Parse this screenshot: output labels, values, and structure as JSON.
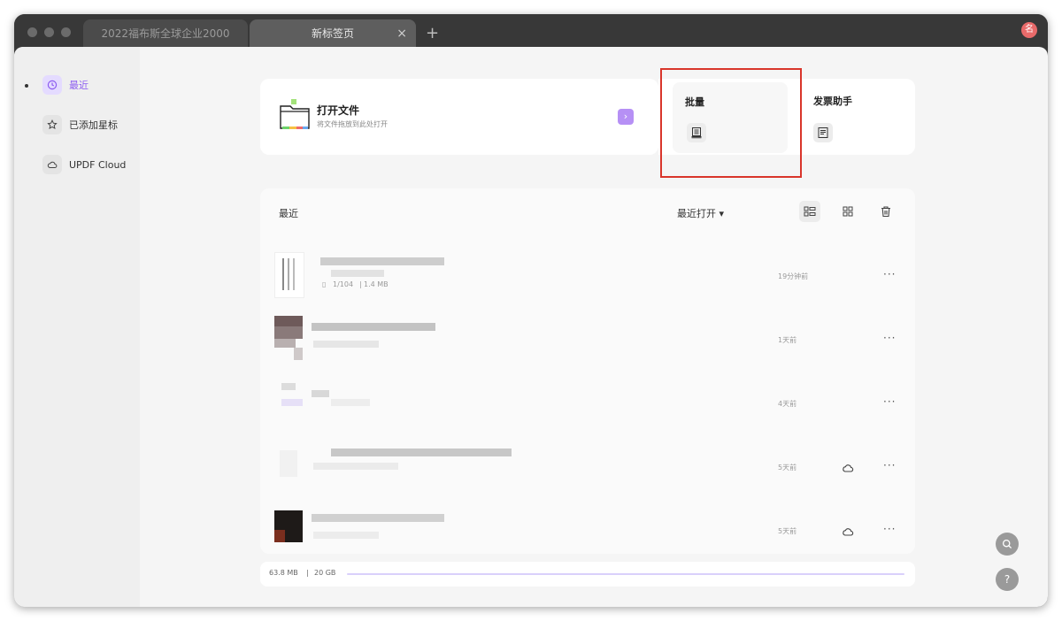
{
  "tabs": [
    {
      "label": "2022福布斯全球企业2000"
    },
    {
      "label": "新标签页"
    }
  ],
  "tab_close": "×",
  "tab_add": "+",
  "avatar": {
    "letter": "名",
    "color": "#e86a6a"
  },
  "sidebar": {
    "items": [
      {
        "label": "最近",
        "icon": "clock-icon",
        "active": true
      },
      {
        "label": "已添加星标",
        "icon": "star-icon"
      },
      {
        "label": "UPDF Cloud",
        "icon": "cloud-icon"
      }
    ]
  },
  "open_card": {
    "title": "打开文件",
    "subtitle": "将文件拖放到此处打开",
    "arrow": "›",
    "icon": "folder-icon"
  },
  "tools": {
    "batch": {
      "label": "批量",
      "icon": "batch-document-icon"
    },
    "invoice": {
      "label": "发票助手",
      "icon": "invoice-document-icon"
    }
  },
  "recent": {
    "title": "最近",
    "sort": "最近打开 ▾",
    "view_buttons": [
      "list-view-icon",
      "grid-view-icon",
      "trash-icon"
    ],
    "rows": [
      {
        "time": "19分钟前",
        "pages": "1/104",
        "size": "1.4 MB",
        "cloud": false
      },
      {
        "time": "1天前",
        "cloud": false
      },
      {
        "time": "4天前",
        "cloud": false
      },
      {
        "time": "5天前",
        "cloud": true
      },
      {
        "time": "5天前",
        "cloud": true
      }
    ],
    "more": "···"
  },
  "storage": {
    "used": "63.8 MB",
    "total": "20 GB",
    "separator": "|"
  },
  "floating": {
    "search_icon": "search-icon",
    "help": "?"
  },
  "colors": {
    "accent": "#8c5cf0",
    "highlight_box": "#d9352b"
  }
}
